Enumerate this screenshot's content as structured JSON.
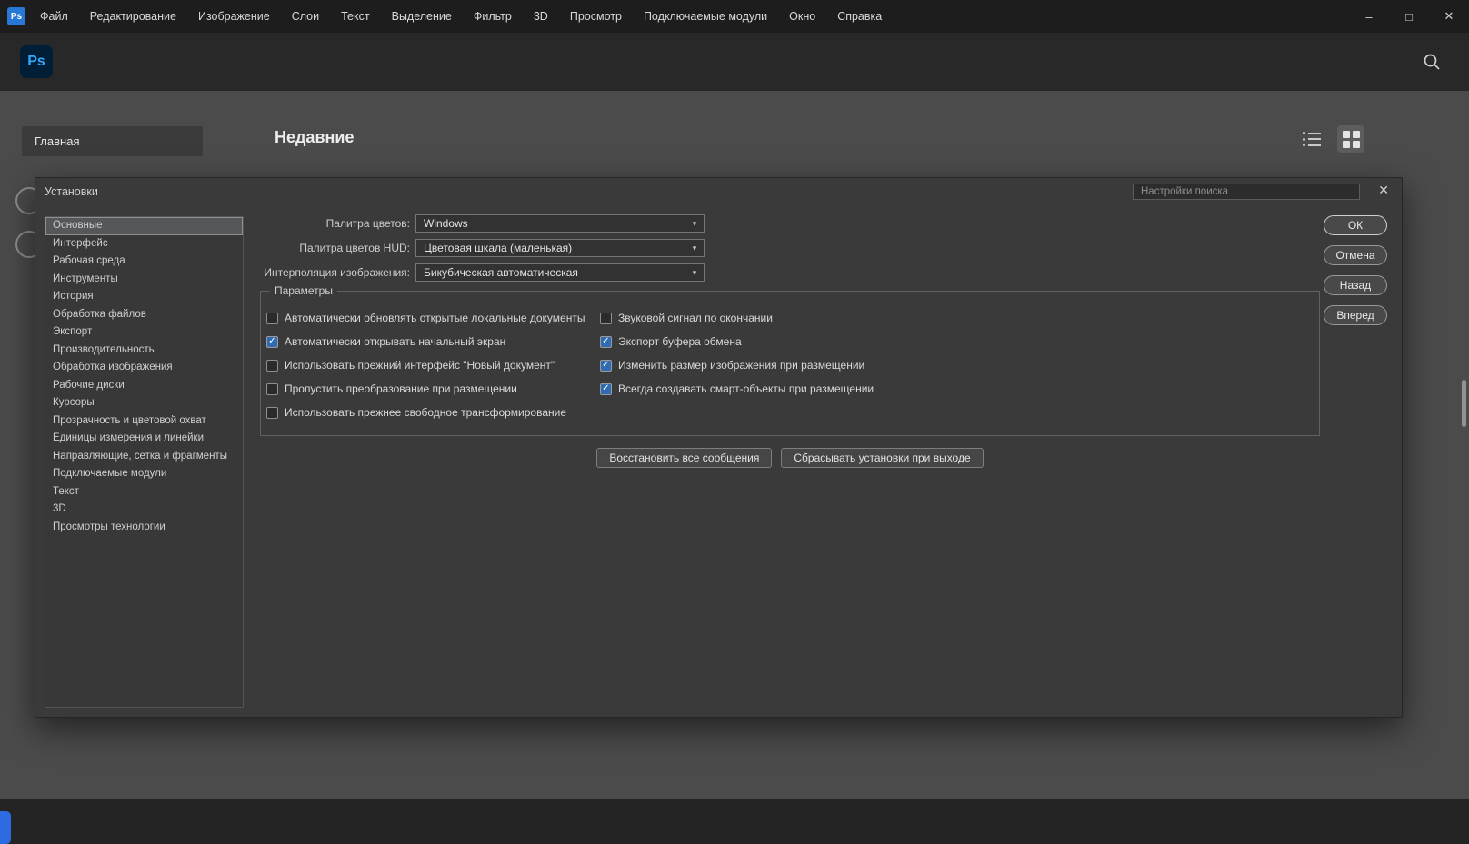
{
  "window": {
    "app_badge": "Ps",
    "menus": [
      "Файл",
      "Редактирование",
      "Изображение",
      "Слои",
      "Текст",
      "Выделение",
      "Фильтр",
      "3D",
      "Просмотр",
      "Подключаемые модули",
      "Окно",
      "Справка"
    ],
    "controls": {
      "minimize": "–",
      "maximize": "□",
      "close": "✕"
    }
  },
  "header": {
    "logo": "Ps"
  },
  "home": {
    "home_tab": "Главная",
    "section_title": "Недавние"
  },
  "dialog": {
    "title": "Установки",
    "search_placeholder": "Настройки поиска",
    "close_glyph": "✕",
    "chevron_glyph": "▾",
    "check_glyph": "✓",
    "sidebar": {
      "selected_index": 0,
      "items": [
        "Основные",
        "Интерфейс",
        "Рабочая среда",
        "Инструменты",
        "История",
        "Обработка файлов",
        "Экспорт",
        "Производительность",
        "Обработка изображения",
        "Рабочие диски",
        "Курсоры",
        "Прозрачность и цветовой охват",
        "Единицы измерения и линейки",
        "Направляющие, сетка и фрагменты",
        "Подключаемые модули",
        "Текст",
        "3D",
        "Просмотры технологии"
      ]
    },
    "fields": [
      {
        "label": "Палитра цветов:",
        "value": "Windows"
      },
      {
        "label": "Палитра цветов HUD:",
        "value": "Цветовая шкала (маленькая)"
      },
      {
        "label": "Интерполяция изображения:",
        "value": "Бикубическая автоматическая"
      }
    ],
    "options_group": {
      "legend": "Параметры",
      "left": [
        {
          "label": "Автоматически обновлять открытые локальные документы",
          "checked": false
        },
        {
          "label": "Автоматически открывать начальный экран",
          "checked": true
        },
        {
          "label": "Использовать прежний интерфейс \"Новый документ\"",
          "checked": false
        },
        {
          "label": "Пропустить преобразование при размещении",
          "checked": false
        },
        {
          "label": "Использовать прежнее свободное трансформирование",
          "checked": false
        }
      ],
      "right": [
        {
          "label": "Звуковой сигнал по окончании",
          "checked": false
        },
        {
          "label": "Экспорт буфера обмена",
          "checked": true
        },
        {
          "label": "Изменить размер изображения при размещении",
          "checked": true
        },
        {
          "label": "Всегда создавать смарт-объекты при размещении",
          "checked": true
        }
      ]
    },
    "action_buttons": [
      "Восстановить все сообщения",
      "Сбрасывать установки при выходе"
    ],
    "side_buttons": [
      "ОК",
      "Отмена",
      "Назад",
      "Вперед"
    ]
  },
  "icons": {
    "search": "magnifier",
    "list_view": "list-lines",
    "grid_view": "grid-squares"
  },
  "colors": {
    "logo_bg": "#001e36",
    "logo_text": "#31a8ff",
    "accent_blue": "#2d6ce0",
    "checked_fill": "#2f6cb3"
  }
}
